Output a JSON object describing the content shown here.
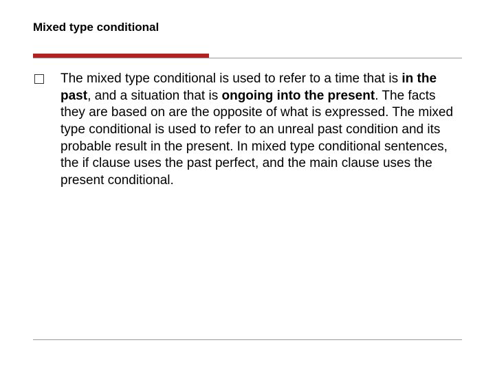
{
  "title": "Mixed type conditional",
  "body": {
    "part1": "The mixed type conditional is used to refer to a time that is ",
    "bold1": "in the past",
    "part2": ", and a situation that is ",
    "bold2": "ongoing into the present",
    "part3": ". The facts they are based on are the opposite of what is expressed. The mixed type conditional is used to refer to an unreal past condition and its probable result in the present. In mixed type conditional sentences, the if clause uses the past perfect, and the main clause uses the present conditional."
  }
}
